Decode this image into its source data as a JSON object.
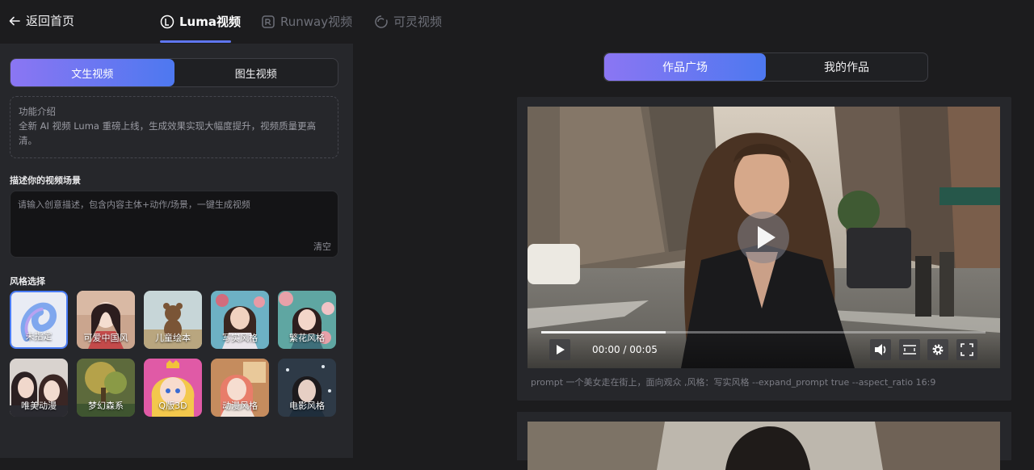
{
  "topbar": {
    "back_label": "返回首页",
    "tabs": [
      {
        "label": "Luma视频",
        "active": true
      },
      {
        "label": "Runway视频",
        "active": false
      },
      {
        "label": "可灵视频",
        "active": false
      }
    ]
  },
  "left": {
    "mode_tabs": [
      "文生视频",
      "图生视频"
    ],
    "intro_title": "功能介绍",
    "intro_text": "全新 AI 视频 Luma 重磅上线，生成效果实现大幅度提升，视频质量更高清。",
    "scene_label": "描述你的视频场景",
    "scene_placeholder": "请输入创意描述，包含内容主体+动作/场景，一键生成视频",
    "clear_label": "清空",
    "style_label": "风格选择",
    "styles": [
      {
        "name": "未指定",
        "selected": true
      },
      {
        "name": "可爱中国风",
        "selected": false
      },
      {
        "name": "儿童绘本",
        "selected": false
      },
      {
        "name": "写实风格",
        "selected": false
      },
      {
        "name": "繁花风格",
        "selected": false
      },
      {
        "name": "唯美动漫",
        "selected": false
      },
      {
        "name": "梦幻森系",
        "selected": false
      },
      {
        "name": "Q版3D",
        "selected": false
      },
      {
        "name": "动漫风格",
        "selected": false
      },
      {
        "name": "电影风格",
        "selected": false
      }
    ]
  },
  "right": {
    "gallery_tabs": [
      "作品广场",
      "我的作品"
    ],
    "video": {
      "time_display": "00:00 / 00:05",
      "progress": 0.28,
      "prompt": "prompt 一个美女走在街上，面向观众 ,风格：写实风格 --expand_prompt true --aspect_ratio 16:9"
    }
  },
  "colors": {
    "accent_start": "#8b76f3",
    "accent_end": "#4d78f0",
    "panel_bg": "#26272b",
    "page_bg": "#1c1c1e"
  }
}
